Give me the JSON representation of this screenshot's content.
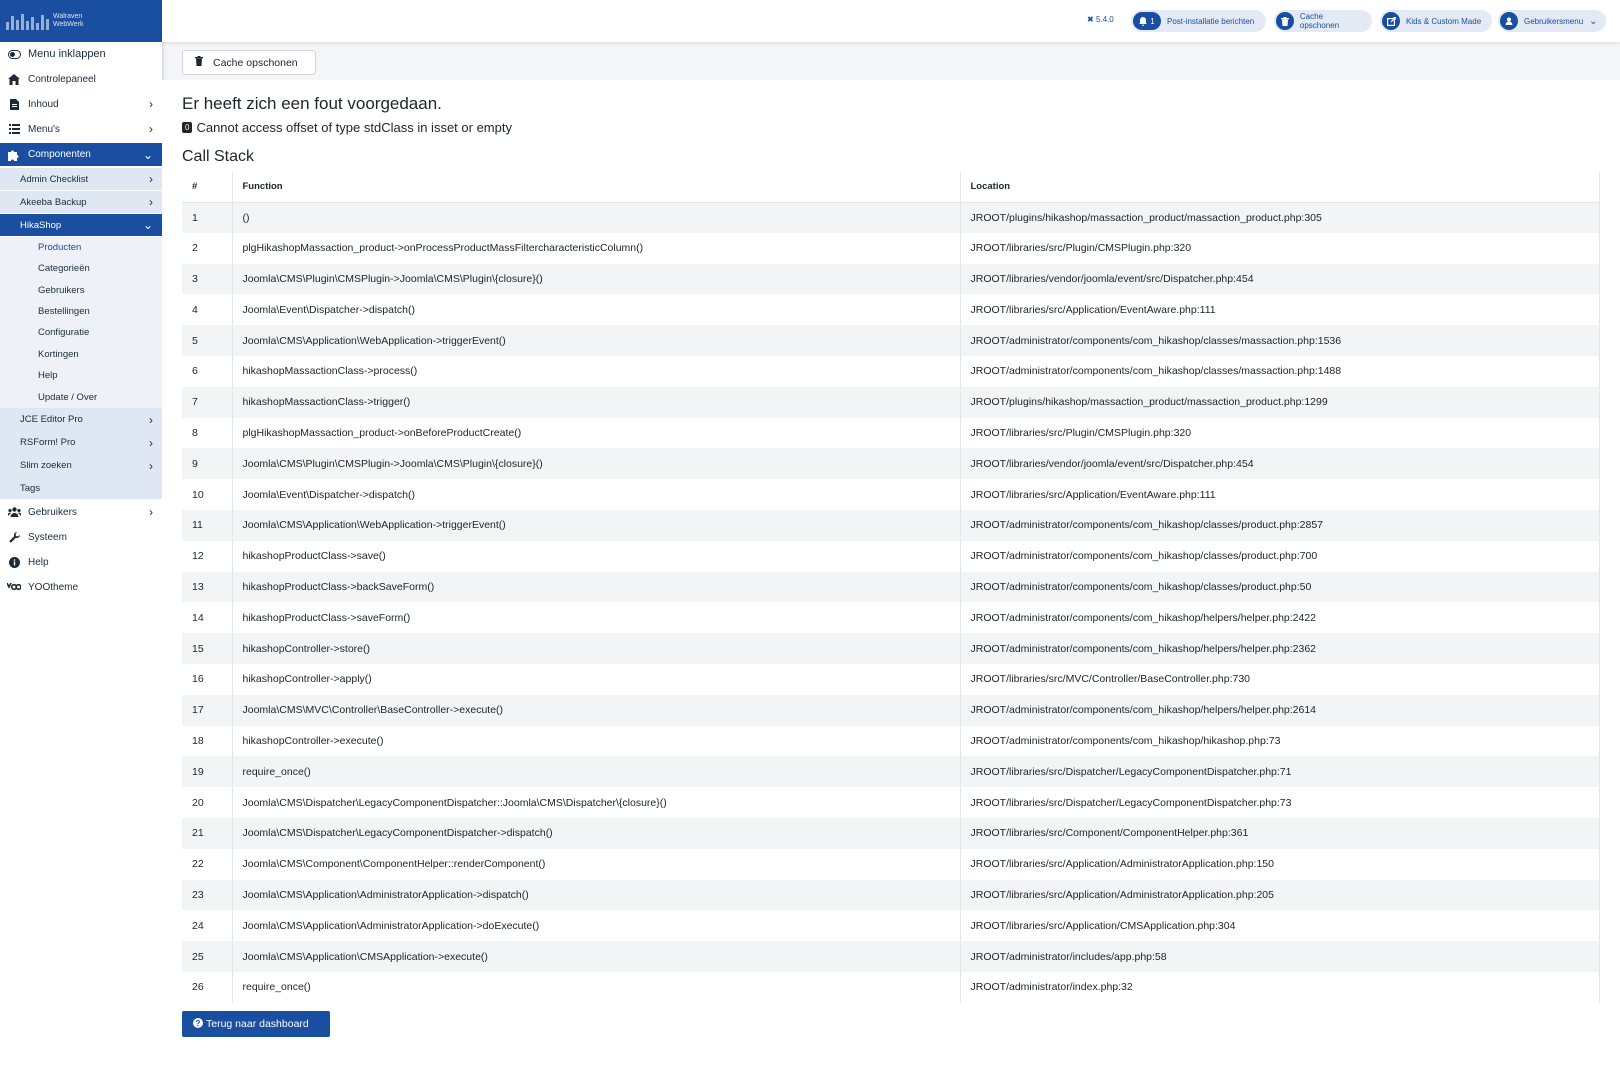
{
  "logo": {
    "line1": "Walraven",
    "line2": "WebWerk"
  },
  "sidebar": {
    "toggle": "Menu inklappen",
    "items": [
      {
        "label": "Controlepaneel",
        "icon": "home-icon"
      },
      {
        "label": "Inhoud",
        "icon": "file-icon"
      },
      {
        "label": "Menu's",
        "icon": "list-icon"
      },
      {
        "label": "Componenten",
        "icon": "puzzle-icon"
      }
    ],
    "components": [
      "Admin Checklist",
      "Akeeba Backup",
      "HikaShop"
    ],
    "hikashop": [
      "Producten",
      "Categorieën",
      "Gebruikers",
      "Bestellingen",
      "Configuratie",
      "Kortingen",
      "Help",
      "Update / Over"
    ],
    "more_components": [
      "JCE Editor Pro",
      "RSForm! Pro",
      "Slim zoeken",
      "Tags"
    ],
    "bottom": [
      {
        "label": "Gebruikers",
        "icon": "users-icon"
      },
      {
        "label": "Systeem",
        "icon": "wrench-icon"
      },
      {
        "label": "Help",
        "icon": "info-icon"
      },
      {
        "label": "YOOtheme",
        "icon": "yootheme-icon"
      }
    ]
  },
  "header": {
    "version": "5.4.0",
    "post_install_count": "1",
    "post_install": "Post-installatie berichten",
    "cache": "Cache opschonen",
    "site": "Kids & Custom Made",
    "user_menu": "Gebruikersmenu"
  },
  "toolbar": {
    "cache_button": "Cache opschonen"
  },
  "error": {
    "title": "Er heeft zich een fout voorgedaan.",
    "code": "0",
    "message": "Cannot access offset of type stdClass in isset or empty"
  },
  "stack": {
    "title": "Call Stack",
    "headers": [
      "#",
      "Function",
      "Location"
    ],
    "rows": [
      [
        "1",
        "()",
        "JROOT/plugins/hikashop/massaction_product/massaction_product.php:305"
      ],
      [
        "2",
        "plgHikashopMassaction_product->onProcessProductMassFiltercharacteristicColumn()",
        "JROOT/libraries/src/Plugin/CMSPlugin.php:320"
      ],
      [
        "3",
        "Joomla\\CMS\\Plugin\\CMSPlugin->Joomla\\CMS\\Plugin\\{closure}()",
        "JROOT/libraries/vendor/joomla/event/src/Dispatcher.php:454"
      ],
      [
        "4",
        "Joomla\\Event\\Dispatcher->dispatch()",
        "JROOT/libraries/src/Application/EventAware.php:111"
      ],
      [
        "5",
        "Joomla\\CMS\\Application\\WebApplication->triggerEvent()",
        "JROOT/administrator/components/com_hikashop/classes/massaction.php:1536"
      ],
      [
        "6",
        "hikashopMassactionClass->process()",
        "JROOT/administrator/components/com_hikashop/classes/massaction.php:1488"
      ],
      [
        "7",
        "hikashopMassactionClass->trigger()",
        "JROOT/plugins/hikashop/massaction_product/massaction_product.php:1299"
      ],
      [
        "8",
        "plgHikashopMassaction_product->onBeforeProductCreate()",
        "JROOT/libraries/src/Plugin/CMSPlugin.php:320"
      ],
      [
        "9",
        "Joomla\\CMS\\Plugin\\CMSPlugin->Joomla\\CMS\\Plugin\\{closure}()",
        "JROOT/libraries/vendor/joomla/event/src/Dispatcher.php:454"
      ],
      [
        "10",
        "Joomla\\Event\\Dispatcher->dispatch()",
        "JROOT/libraries/src/Application/EventAware.php:111"
      ],
      [
        "11",
        "Joomla\\CMS\\Application\\WebApplication->triggerEvent()",
        "JROOT/administrator/components/com_hikashop/classes/product.php:2857"
      ],
      [
        "12",
        "hikashopProductClass->save()",
        "JROOT/administrator/components/com_hikashop/classes/product.php:700"
      ],
      [
        "13",
        "hikashopProductClass->backSaveForm()",
        "JROOT/administrator/components/com_hikashop/classes/product.php:50"
      ],
      [
        "14",
        "hikashopProductClass->saveForm()",
        "JROOT/administrator/components/com_hikashop/helpers/helper.php:2422"
      ],
      [
        "15",
        "hikashopController->store()",
        "JROOT/administrator/components/com_hikashop/helpers/helper.php:2362"
      ],
      [
        "16",
        "hikashopController->apply()",
        "JROOT/libraries/src/MVC/Controller/BaseController.php:730"
      ],
      [
        "17",
        "Joomla\\CMS\\MVC\\Controller\\BaseController->execute()",
        "JROOT/administrator/components/com_hikashop/helpers/helper.php:2614"
      ],
      [
        "18",
        "hikashopController->execute()",
        "JROOT/administrator/components/com_hikashop/hikashop.php:73"
      ],
      [
        "19",
        "require_once()",
        "JROOT/libraries/src/Dispatcher/LegacyComponentDispatcher.php:71"
      ],
      [
        "20",
        "Joomla\\CMS\\Dispatcher\\LegacyComponentDispatcher::Joomla\\CMS\\Dispatcher\\{closure}()",
        "JROOT/libraries/src/Dispatcher/LegacyComponentDispatcher.php:73"
      ],
      [
        "21",
        "Joomla\\CMS\\Dispatcher\\LegacyComponentDispatcher->dispatch()",
        "JROOT/libraries/src/Component/ComponentHelper.php:361"
      ],
      [
        "22",
        "Joomla\\CMS\\Component\\ComponentHelper::renderComponent()",
        "JROOT/libraries/src/Application/AdministratorApplication.php:150"
      ],
      [
        "23",
        "Joomla\\CMS\\Application\\AdministratorApplication->dispatch()",
        "JROOT/libraries/src/Application/AdministratorApplication.php:205"
      ],
      [
        "24",
        "Joomla\\CMS\\Application\\AdministratorApplication->doExecute()",
        "JROOT/libraries/src/Application/CMSApplication.php:304"
      ],
      [
        "25",
        "Joomla\\CMS\\Application\\CMSApplication->execute()",
        "JROOT/administrator/includes/app.php:58"
      ],
      [
        "26",
        "require_once()",
        "JROOT/administrator/index.php:32"
      ]
    ]
  },
  "back_button": "Terug naar dashboard",
  "colors": {
    "primary": "#1a4ea1",
    "sub_bg": "#dfe7f3",
    "sub2_bg": "#eef2f8"
  }
}
